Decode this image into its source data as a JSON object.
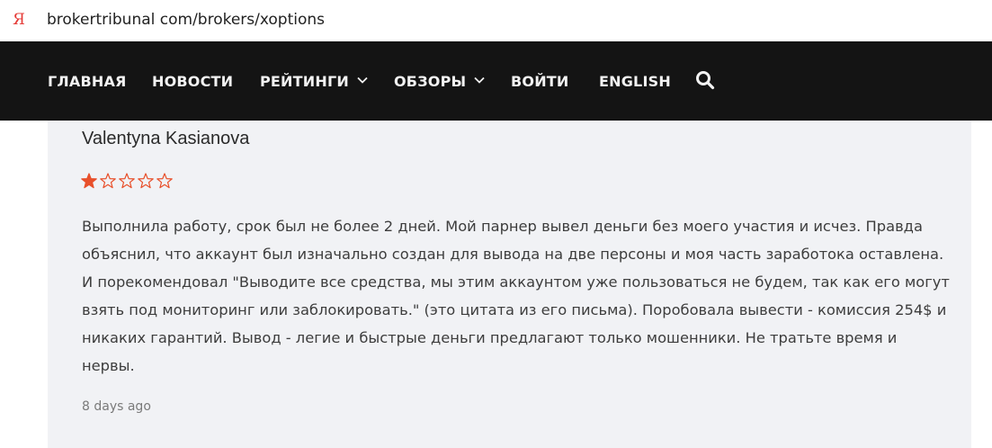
{
  "browser": {
    "favicon_icon": "yandex-icon",
    "favicon_glyph": "Я",
    "url": "brokertribunal com/brokers/xoptions"
  },
  "nav": {
    "items": [
      {
        "label": "ГЛАВНАЯ",
        "dropdown": false
      },
      {
        "label": "НОВОСТИ",
        "dropdown": false
      },
      {
        "label": "РЕЙТИНГИ",
        "dropdown": true
      },
      {
        "label": "ОБЗОРЫ",
        "dropdown": true
      },
      {
        "label": "ВОЙТИ",
        "dropdown": false
      },
      {
        "label": "ENGLISH",
        "dropdown": false
      }
    ],
    "search_icon": "search-icon",
    "background": "#141414"
  },
  "review": {
    "author": "Valentyna Kasianova",
    "rating": 1,
    "rating_max": 5,
    "star_color": "#e8502b",
    "text": "Выполнила работу, срок был не более 2 дней. Мой парнер вывел деньги без моего участия и исчез. Правда объяснил, что аккаунт был изначально создан для вывода на две персоны и моя часть заработока оставлена. И порекомендовал \"Выводите все средства, мы этим аккаунтом уже пользоваться не будем, так как его могут взять под мониторинг или заблокировать.\" (это цитата из его письма). Поробовала вывести - комиссия 254$ и никаких гарантий. Вывод - легие и быстрые деньги предлагают только мошенники. Не тратьте время и нервы.",
    "time_ago": "8 days ago"
  }
}
